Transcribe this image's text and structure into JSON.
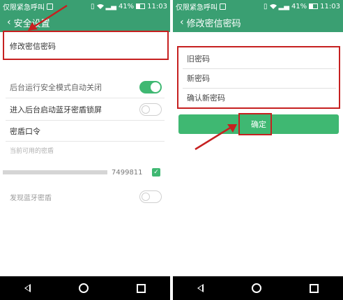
{
  "status_bar": {
    "carrier": "仅限紧急呼叫",
    "battery": "41%",
    "time": "11:03"
  },
  "left_screen": {
    "title": "安全设置",
    "change_password": "修改密信密码",
    "rows": [
      {
        "label": "后台运行安全模式自动关闭",
        "toggle": "on"
      },
      {
        "label": "进入后台启动蓝牙密盾锁屏",
        "toggle": "off"
      },
      {
        "label": "密盾口令"
      },
      {
        "label": "当前可用的密盾"
      },
      {
        "label": "7499811",
        "checked": true
      },
      {
        "label": "发现蓝牙密盾",
        "toggle": "off"
      }
    ]
  },
  "right_screen": {
    "title": "修改密信密码",
    "old_password_placeholder": "旧密码",
    "new_password_placeholder": "新密码",
    "confirm_password_placeholder": "确认新密码",
    "confirm_button": "确定"
  },
  "colors": {
    "header_green": "#3a9f72",
    "toggle_green": "#3fb872",
    "annotation_red": "#c62020"
  },
  "icons": {
    "back": "chevron-left-icon",
    "nav_back": "triangle-back-icon",
    "nav_home": "circle-home-icon",
    "nav_recent": "square-recent-icon"
  }
}
